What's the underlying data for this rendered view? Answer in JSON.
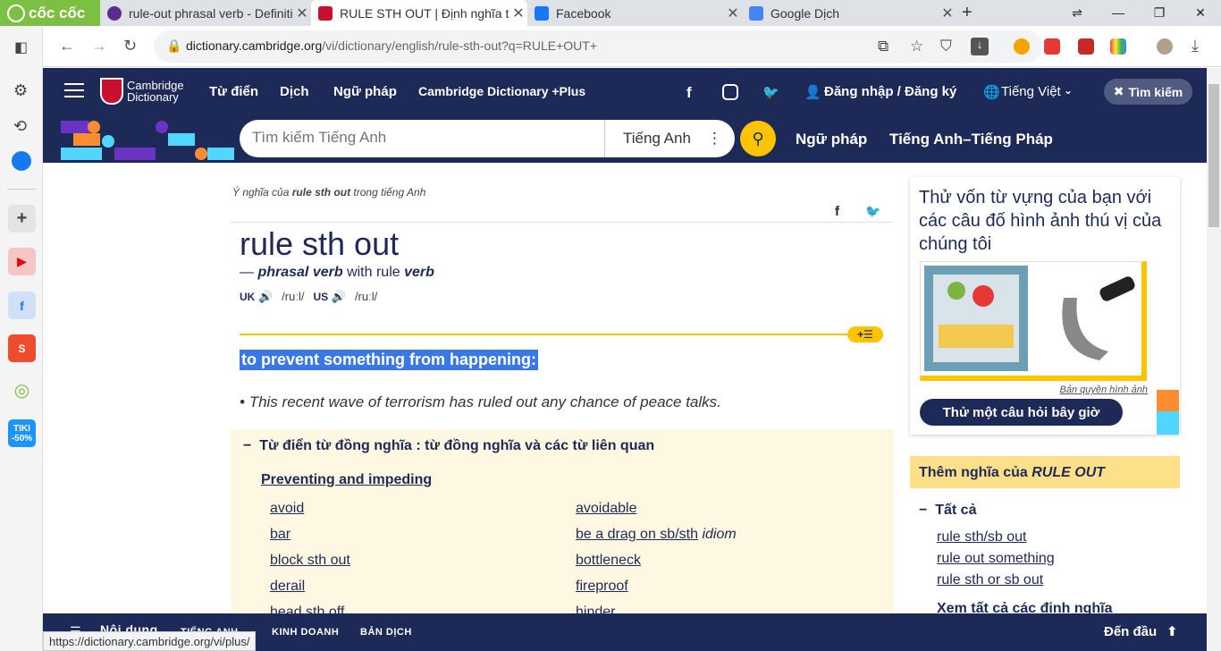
{
  "browser": {
    "brand": "cốc cốc",
    "tabs": [
      {
        "title": "rule-out phrasal verb - Definiti",
        "active": false
      },
      {
        "title": "RULE STH OUT | Định nghĩa tr",
        "active": true
      },
      {
        "title": "Facebook",
        "active": false
      },
      {
        "title": "Google Dịch",
        "active": false
      }
    ],
    "url_host": "dictionary.cambridge.org",
    "url_path": "/vi/dictionary/english/rule-sth-out?q=RULE+OUT+",
    "status_url": "https://dictionary.cambridge.org/vi/plus/"
  },
  "topnav": {
    "logo_line1": "Cambridge",
    "logo_line2": "Dictionary",
    "items": [
      "Từ điển",
      "Dịch",
      "Ngữ pháp",
      "Cambridge Dictionary +Plus"
    ],
    "login": "Đăng nhập / Đăng ký",
    "language": "Tiếng Việt",
    "search_button": "Tìm kiếm"
  },
  "subnav": {
    "search_placeholder": "Tìm kiếm Tiếng Anh",
    "search_language": "Tiếng Anh",
    "links": [
      "Ngữ pháp",
      "Tiếng Anh–Tiếng Pháp"
    ]
  },
  "entry": {
    "crumb_prefix": "Ý nghĩa của",
    "crumb_word": "rule sth out",
    "crumb_suffix": "trong tiếng Anh",
    "headword": "rule sth out",
    "pos_dash": "—",
    "pos": "phrasal verb",
    "pos_with": "with rule",
    "pos_verb": "verb",
    "uk_label": "UK",
    "uk_ipa": "/ruːl/",
    "us_label": "US",
    "us_ipa": "/ruːl/",
    "definition": "to prevent something from happening:",
    "example": "This recent wave of terrorism has ruled out any chance of peace talks."
  },
  "thesaurus": {
    "heading": "Từ điển từ đồng nghĩa : từ đồng nghĩa và các từ liên quan",
    "subheading": "Preventing and impeding",
    "left": [
      "avoid",
      "bar",
      "block sth out",
      "derail",
      "head sth off"
    ],
    "right": [
      "avoidable",
      "be a drag on sb/sth",
      "bottleneck",
      "fireproof",
      "hinder"
    ],
    "right_idiom_tag": "idiom"
  },
  "quiz": {
    "question": "Thử vốn từ vựng của bạn với các câu đố hình ảnh thú vị của chúng tôi",
    "credit": "Bản quyền hình ảnh",
    "button": "Thử một câu hỏi bây giờ"
  },
  "more_meanings": {
    "heading_prefix": "Thêm nghĩa của",
    "heading_word": "RULE OUT",
    "all_label": "Tất cả",
    "links": [
      "rule sth/sb out",
      "rule out something",
      "rule sth or sb out"
    ],
    "see_all": "Xem tất cả các định nghĩa"
  },
  "bottombar": {
    "items": [
      "Nội dung",
      "TIẾNG ANH",
      "KINH DOANH",
      "BẢN DỊCH"
    ],
    "to_top": "Đến đầu"
  },
  "colors": {
    "brand_navy": "#1d2a57",
    "accent_yellow": "#fec400",
    "highlight_blue": "#3b78e7",
    "thesaurus_bg": "#fef7e1"
  }
}
